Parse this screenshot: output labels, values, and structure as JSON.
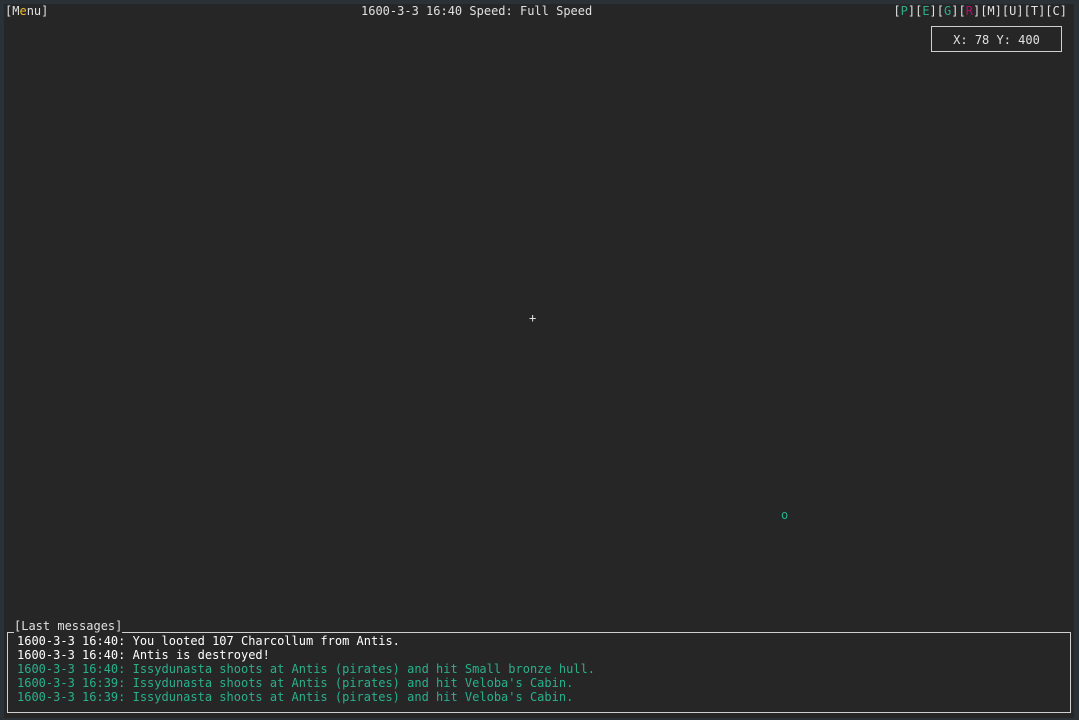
{
  "topbar": {
    "menu": {
      "open": "[",
      "first": "M",
      "hotkey": "e",
      "rest": "nu",
      "close": "]"
    },
    "status": {
      "date": "1600-3-3 16:40",
      "speed_label": "Speed:",
      "speed_value": "Full Speed"
    },
    "shortcuts": [
      {
        "key": "P",
        "color": "#2ab08a"
      },
      {
        "key": "E",
        "color": "#2ab08a"
      },
      {
        "key": "G",
        "color": "#2ab08a"
      },
      {
        "key": "R",
        "color": "#b0106a"
      },
      {
        "key": "M",
        "color": "#e0e0e0"
      },
      {
        "key": "U",
        "color": "#e0e0e0"
      },
      {
        "key": "T",
        "color": "#e0e0e0"
      },
      {
        "key": "C",
        "color": "#e0e0e0"
      }
    ]
  },
  "coordinates": {
    "text": "X: 78 Y: 400"
  },
  "map": {
    "cursor_symbol": "+",
    "ship_symbol": "o"
  },
  "messages": {
    "title": "[Last messages]",
    "lines": [
      {
        "text": "1600-3-3 16:40: You looted 107 Charcollum from Antis.",
        "color": "white"
      },
      {
        "text": "1600-3-3 16:40: Antis is destroyed!",
        "color": "white"
      },
      {
        "text": "1600-3-3 16:40: Issydunasta shoots at Antis (pirates) and hit Small bronze hull.",
        "color": "green"
      },
      {
        "text": "1600-3-3 16:39: Issydunasta shoots at Antis (pirates) and hit Veloba's Cabin.",
        "color": "green"
      },
      {
        "text": "1600-3-3 16:39: Issydunasta shoots at Antis (pirates) and hit Veloba's Cabin.",
        "color": "green"
      }
    ]
  },
  "colors": {
    "background": "#262626",
    "accent_green": "#2ab08a",
    "accent_red": "#b0106a",
    "hotkey_yellow": "#e8c01c"
  }
}
